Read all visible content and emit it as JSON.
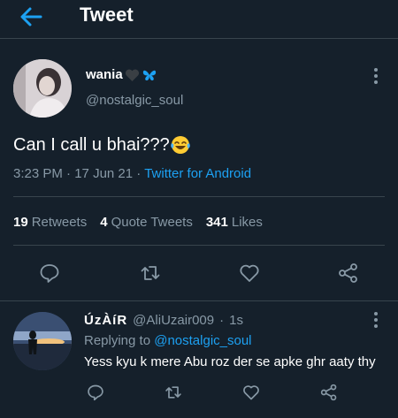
{
  "header": {
    "title": "Tweet",
    "back_icon": "arrow-left-icon"
  },
  "tweet": {
    "display_name": "wania",
    "handle": "@nostalgic_soul",
    "text": "Can I call u bhai???",
    "time": "3:23 PM",
    "separator": "·",
    "date": "17 Jun 21",
    "source": "Twitter for Android",
    "stats": {
      "retweets_count": "19",
      "retweets_label": "Retweets",
      "quotes_count": "4",
      "quotes_label": "Quote Tweets",
      "likes_count": "341",
      "likes_label": "Likes"
    }
  },
  "reply": {
    "display_name": "ÚzÀíR",
    "handle": "@AliUzair009",
    "separator": "·",
    "time": "1s",
    "replying_prefix": "Replying to",
    "replying_to": "@nostalgic_soul",
    "text": "Yess kyu k mere Abu roz der se apke ghr aaty thy"
  },
  "colors": {
    "background": "#15202b",
    "accent": "#1da1f2",
    "muted": "#8899a6",
    "divider": "#38444d"
  }
}
